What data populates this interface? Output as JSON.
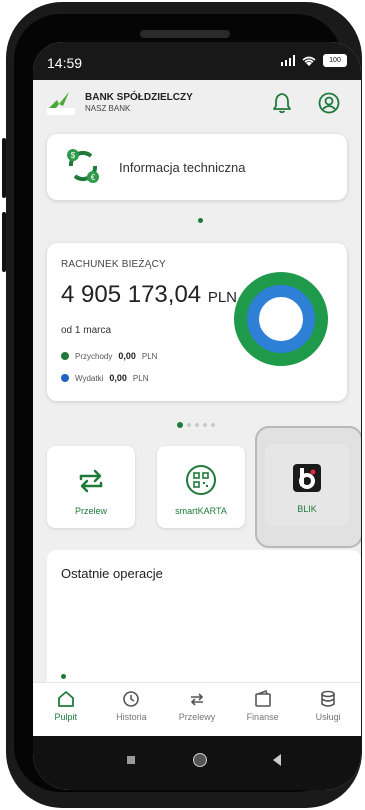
{
  "status": {
    "time": "14:59",
    "battery": "100"
  },
  "bank": {
    "name": "BANK SPÓŁDZIELCZY",
    "sub": "NASZ BANK"
  },
  "info": {
    "label": "Informacja techniczna"
  },
  "account": {
    "title": "RACHUNEK BIEŻĄCY",
    "amount": "4 905 173,04",
    "currency": "PLN",
    "since": "od 1 marca",
    "income_label": "Przychody",
    "income_value": "0,00",
    "income_currency": "PLN",
    "expense_label": "Wydatki",
    "expense_value": "0,00",
    "expense_currency": "PLN",
    "income_color": "#1f7a3a",
    "expense_color": "#2160c4"
  },
  "quick_actions": [
    {
      "label": "Przelew",
      "icon": "transfer-icon"
    },
    {
      "label": "smartKARTA",
      "icon": "qr-card-icon"
    },
    {
      "label": "BLIK",
      "icon": "blik-icon"
    }
  ],
  "recent": {
    "title": "Ostatnie operacje"
  },
  "tabs": [
    {
      "label": "Pulpit",
      "icon": "home-icon"
    },
    {
      "label": "Historia",
      "icon": "history-icon"
    },
    {
      "label": "Przelewy",
      "icon": "transfers-icon"
    },
    {
      "label": "Finanse",
      "icon": "wallet-icon"
    },
    {
      "label": "Usługi",
      "icon": "database-icon"
    }
  ],
  "colors": {
    "accent": "#1f7a3a",
    "blue": "#2160c4"
  }
}
